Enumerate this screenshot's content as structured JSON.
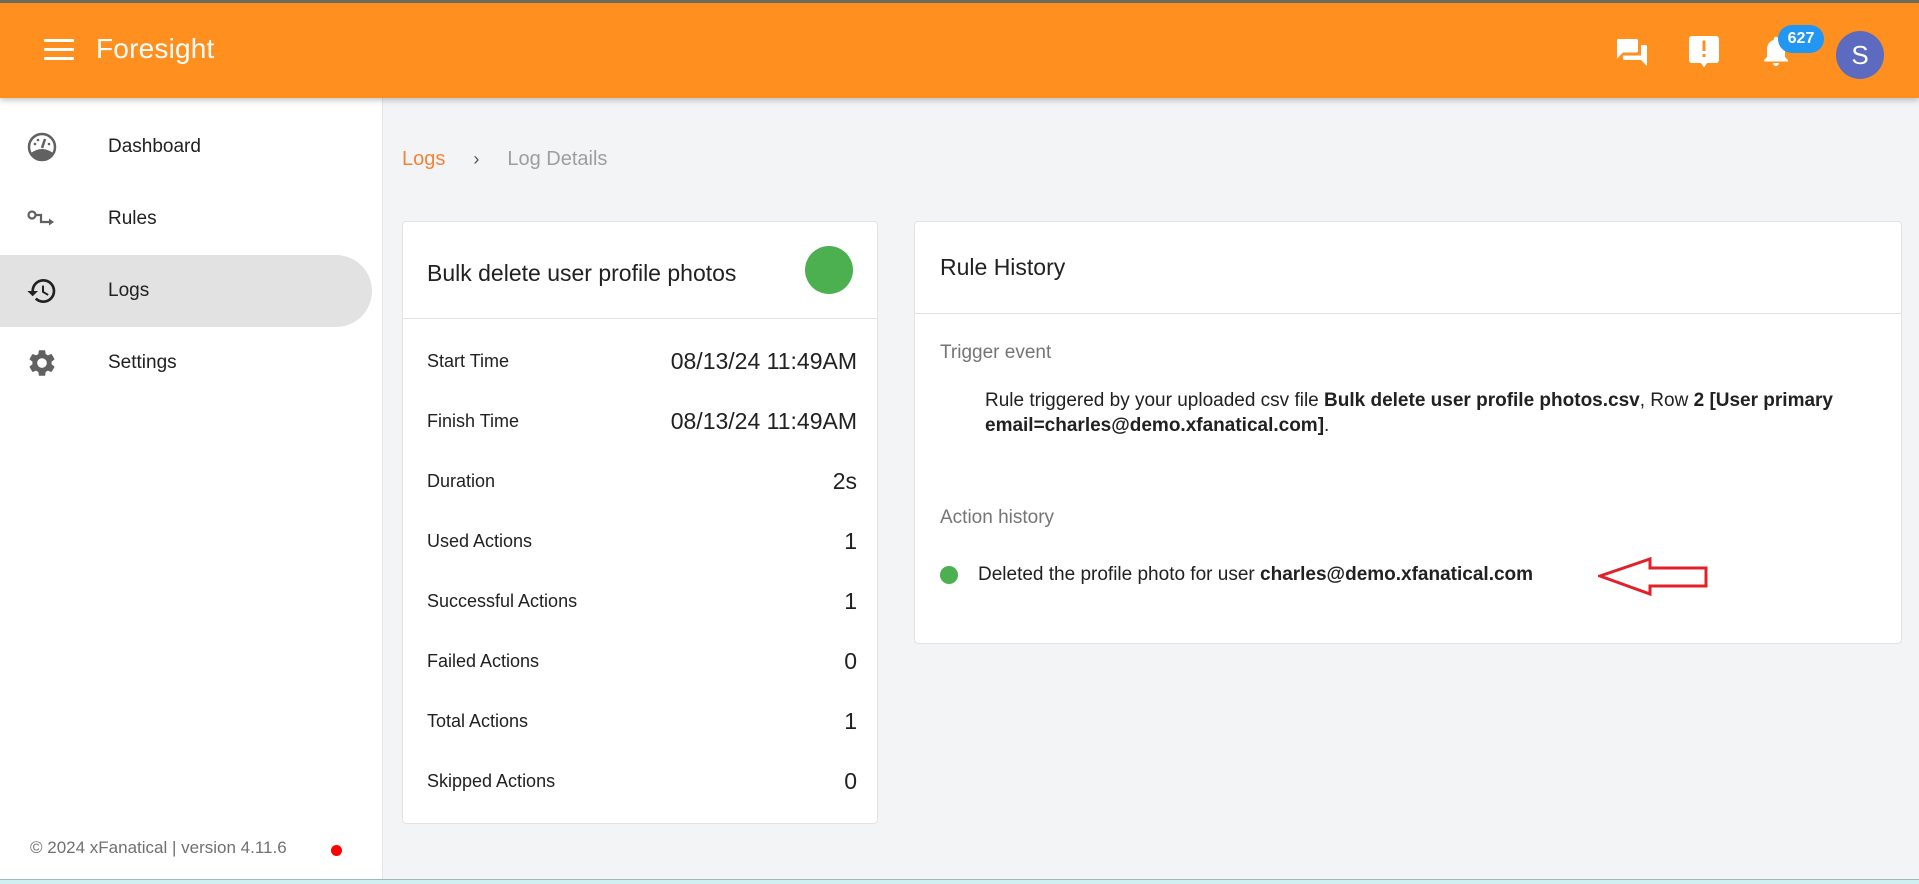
{
  "appbar": {
    "title": "Foresight",
    "notification_count": "627",
    "avatar_initial": "S",
    "icons": [
      "chat-icon",
      "feedback-icon",
      "notifications-bell-icon"
    ],
    "brand_color": "#ff8f1f",
    "badge_color": "#2196f3",
    "avatar_color": "#5c6bc0"
  },
  "sidebar": {
    "items": [
      {
        "label": "Dashboard",
        "icon": "speedometer-icon",
        "active": false
      },
      {
        "label": "Rules",
        "icon": "rule-flow-icon",
        "active": false
      },
      {
        "label": "Logs",
        "icon": "history-icon",
        "active": true
      },
      {
        "label": "Settings",
        "icon": "gear-icon",
        "active": false
      }
    ],
    "footer": "© 2024 xFanatical | version 4.11.6",
    "footer_status_color": "#ff0000"
  },
  "breadcrumb": {
    "parent": "Logs",
    "separator": "›",
    "current": "Log Details"
  },
  "summary": {
    "title": "Bulk delete user profile photos",
    "status": "success",
    "status_color": "#4caf50",
    "rows": [
      {
        "label": "Start Time",
        "value": "08/13/24 11:49AM"
      },
      {
        "label": "Finish Time",
        "value": "08/13/24 11:49AM"
      },
      {
        "label": "Duration",
        "value": "2s"
      },
      {
        "label": "Used Actions",
        "value": "1"
      },
      {
        "label": "Successful Actions",
        "value": "1"
      },
      {
        "label": "Failed Actions",
        "value": "0"
      },
      {
        "label": "Total Actions",
        "value": "1"
      },
      {
        "label": "Skipped Actions",
        "value": "0"
      }
    ]
  },
  "history": {
    "title": "Rule History",
    "trigger_label": "Trigger event",
    "trigger": {
      "prefix": "Rule triggered by your uploaded csv file ",
      "file": "Bulk delete user profile photos.csv",
      "row_text": ", Row ",
      "row_detail": "2 [User primary email=charles@demo.xfanatical.com]",
      "suffix": "."
    },
    "action_label": "Action history",
    "actions": [
      {
        "status": "success",
        "text": "Deleted the profile photo for user ",
        "target": "charles@demo.xfanatical.com"
      }
    ],
    "annotation": "red-arrow-pointing-left"
  }
}
